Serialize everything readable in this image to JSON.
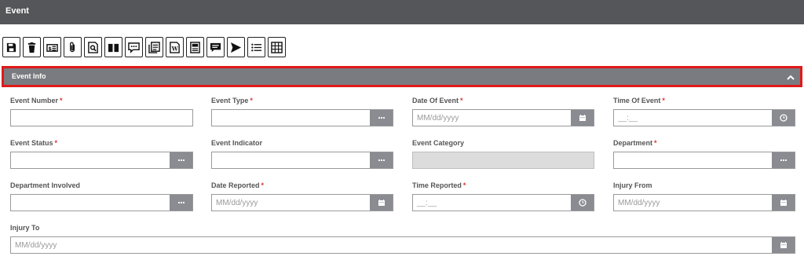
{
  "window": {
    "title": "Event"
  },
  "toolbar": {
    "buttons": [
      {
        "icon": "save-icon"
      },
      {
        "icon": "trash-icon"
      },
      {
        "icon": "money-icon"
      },
      {
        "icon": "paperclip-icon"
      },
      {
        "icon": "document-search-icon"
      },
      {
        "icon": "book-icon"
      },
      {
        "icon": "comment-icon"
      },
      {
        "icon": "documents-icon"
      },
      {
        "icon": "word-doc-icon"
      },
      {
        "icon": "report-icon"
      },
      {
        "icon": "chat-icon"
      },
      {
        "icon": "send-icon"
      },
      {
        "icon": "list-icon"
      },
      {
        "icon": "grid-icon"
      }
    ]
  },
  "section": {
    "title": "Event Info",
    "collapse_icon": "chevron-up-icon"
  },
  "fields": {
    "event_number": {
      "label": "Event Number",
      "required": "*",
      "value": ""
    },
    "event_type": {
      "label": "Event Type",
      "required": "*",
      "value": "",
      "addon": "ellipsis"
    },
    "date_of_event": {
      "label": "Date Of Event",
      "required": "*",
      "placeholder": "MM/dd/yyyy",
      "addon": "calendar"
    },
    "time_of_event": {
      "label": "Time Of Event",
      "required": "*",
      "placeholder": "__:__",
      "addon": "clock"
    },
    "event_status": {
      "label": "Event Status",
      "required": "*",
      "value": "",
      "addon": "ellipsis"
    },
    "event_indicator": {
      "label": "Event Indicator",
      "value": "",
      "addon": "ellipsis"
    },
    "event_category": {
      "label": "Event Category",
      "value": "",
      "disabled": true
    },
    "department": {
      "label": "Department",
      "required": "*",
      "value": "",
      "addon": "ellipsis"
    },
    "department_involved": {
      "label": "Department Involved",
      "value": "",
      "addon": "ellipsis"
    },
    "date_reported": {
      "label": "Date Reported",
      "required": "*",
      "placeholder": "MM/dd/yyyy",
      "addon": "calendar"
    },
    "time_reported": {
      "label": "Time Reported",
      "required": "*",
      "placeholder": "__:__",
      "addon": "clock"
    },
    "injury_from": {
      "label": "Injury From",
      "placeholder": "MM/dd/yyyy",
      "addon": "calendar"
    },
    "injury_to": {
      "label": "Injury To",
      "placeholder": "MM/dd/yyyy",
      "addon": "calendar"
    }
  },
  "colors": {
    "header": "#55565a",
    "section": "#7a7b80",
    "highlight": "#e01919",
    "addon": "#8a8c92",
    "required": "#d33333"
  }
}
